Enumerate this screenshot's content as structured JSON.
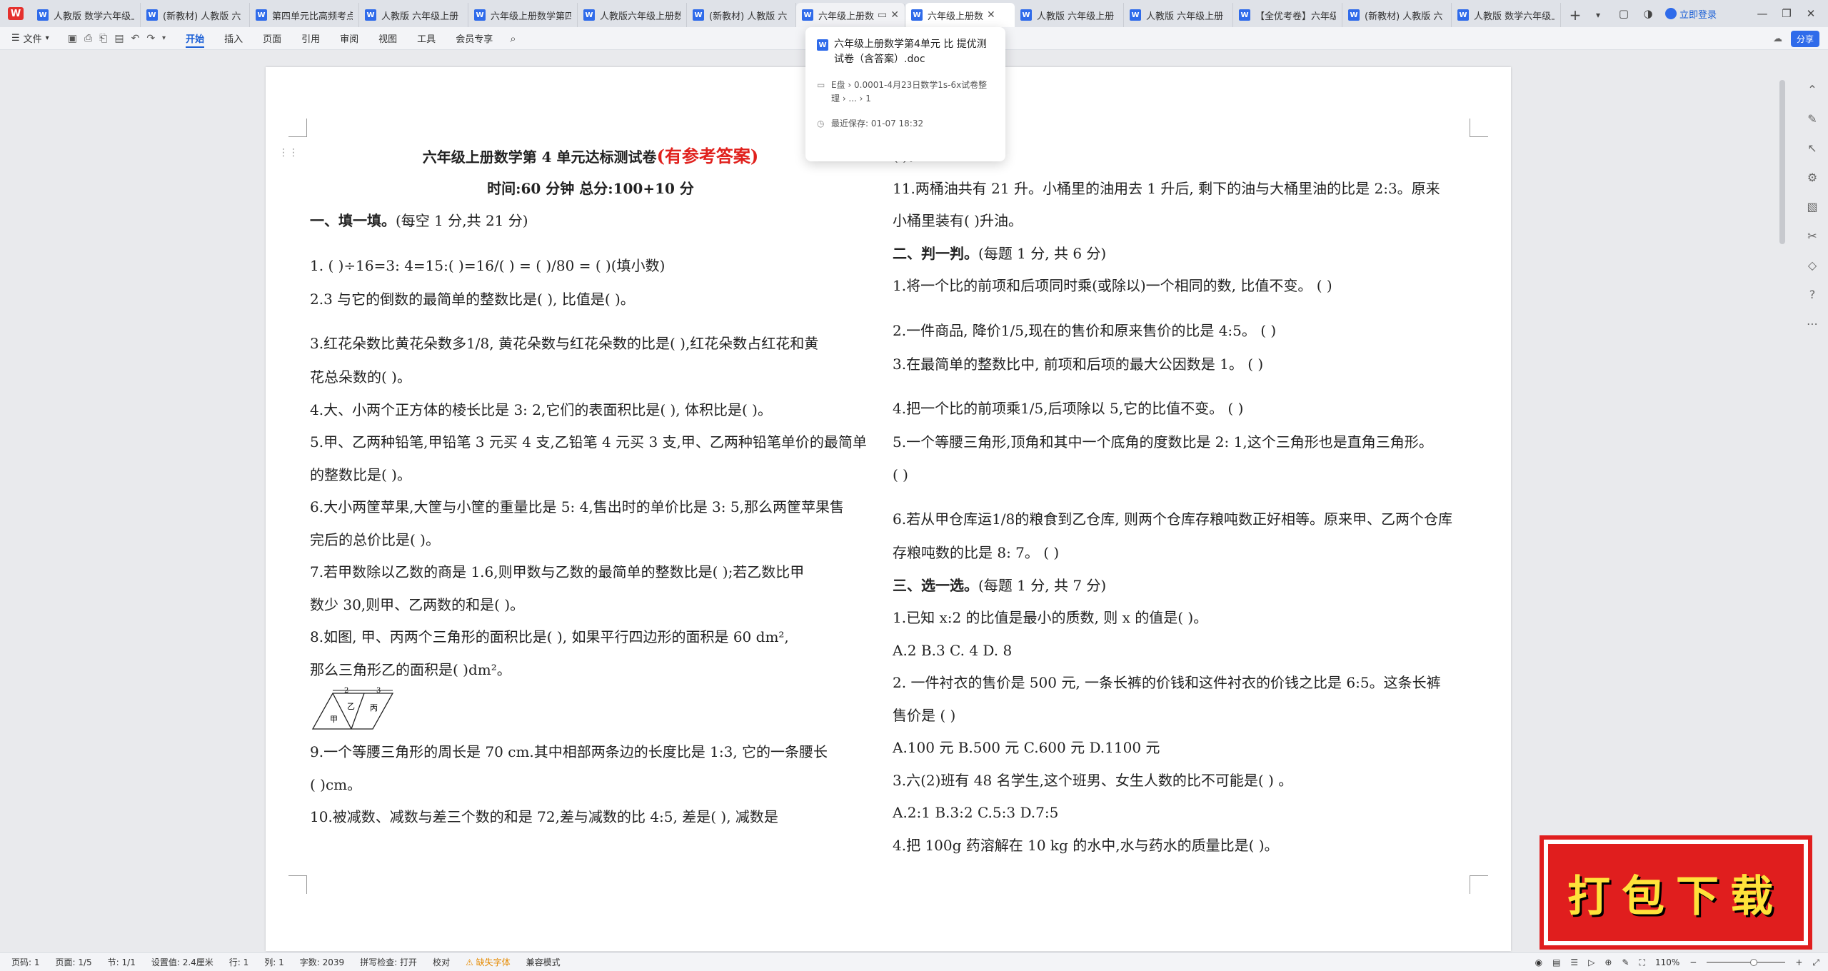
{
  "tabs": [
    {
      "label": "人教版 数学六年级上",
      "state": "normal"
    },
    {
      "label": "(新教材) 人教版 六",
      "state": "normal"
    },
    {
      "label": "第四单元比高频考点",
      "state": "normal"
    },
    {
      "label": "人教版 六年级上册",
      "state": "normal"
    },
    {
      "label": "六年级上册数学第四",
      "state": "normal"
    },
    {
      "label": "人教版六年级上册数",
      "state": "normal"
    },
    {
      "label": "(新教材) 人教版 六",
      "state": "normal"
    },
    {
      "label": "六年级上册数学第",
      "state": "hovered"
    },
    {
      "label": "六年级上册数",
      "state": "active"
    },
    {
      "label": "人教版 六年级上册",
      "state": "normal"
    },
    {
      "label": "人教版 六年级上册",
      "state": "normal"
    },
    {
      "label": "【全优考卷】六年级",
      "state": "normal"
    },
    {
      "label": "(新教材) 人教版 六",
      "state": "normal"
    },
    {
      "label": "人教版 数学六年级上",
      "state": "normal"
    }
  ],
  "titlebar": {
    "login_label": "立即登录"
  },
  "ribbon": {
    "file_label": "文件",
    "menu": [
      "开始",
      "插入",
      "页面",
      "引用",
      "审阅",
      "视图",
      "工具",
      "会员专享"
    ],
    "active_menu": "开始",
    "share_label": "分享"
  },
  "popup": {
    "title": "六年级上册数学第4单元 比 提优测试卷（含答案）.doc",
    "path": "E盘 › 0.0001-4月23日数学1s-6x试卷整理 › ... › 1",
    "saved": "最近保存: 01-07 18:32"
  },
  "document": {
    "left": [
      {
        "type": "title",
        "text": "六年级上册数学第 4 单元达标测试卷",
        "highlight": "(有参考答案)"
      },
      {
        "type": "center",
        "text": "时间:60 分钟    总分:100+10 分"
      },
      {
        "type": "section",
        "head": "一、填一填。",
        "text": "(每空 1 分,共 21 分)"
      },
      {
        "type": "tall",
        "text": "1. (      )÷16=3: 4=15:(      )=16/(   ) = (   )/80 = (      )(填小数)"
      },
      {
        "type": "line",
        "text": "2.3 与它的倒数的最简单的整数比是(         ), 比值是(          )。"
      },
      {
        "type": "tall",
        "text": "3.红花朵数比黄花朵数多1/8, 黄花朵数与红花朵数的比是(         ),红花朵数占红花和黄"
      },
      {
        "type": "line",
        "text": "花总朵数的(         )。"
      },
      {
        "type": "line",
        "text": "4.大、小两个正方体的棱长比是 3: 2,它们的表面积比是(         ), 体积比是(         )。"
      },
      {
        "type": "line",
        "text": "5.甲、乙两种铅笔,甲铅笔 3 元买 4 支,乙铅笔 4 元买 3 支,甲、乙两种铅笔单价的最简单"
      },
      {
        "type": "line",
        "text": "的整数比是(            )。"
      },
      {
        "type": "line",
        "text": "6.大小两筐苹果,大筐与小筐的重量比是 5: 4,售出时的单价比是 3: 5,那么两筐苹果售"
      },
      {
        "type": "line",
        "text": "完后的总价比是(            )。"
      },
      {
        "type": "line",
        "text": "7.若甲数除以乙数的商是 1.6,则甲数与乙数的最简单的整数比是(         );若乙数比甲"
      },
      {
        "type": "line",
        "text": "数少 30,则甲、乙两数的和是(            )。"
      },
      {
        "type": "line",
        "text": "8.如图, 甲、丙两个三角形的面积比是(         ), 如果平行四边形的面积是 60 dm², "
      },
      {
        "type": "line",
        "text": "那么三角形乙的面积是(          )dm²。"
      },
      {
        "type": "figure",
        "labels": [
          "2",
          "3",
          "甲",
          "乙",
          "丙"
        ]
      },
      {
        "type": "line",
        "text": "9.一个等腰三角形的周长是 70 cm.其中相部两条边的长度比是 1:3, 它的一条腰长"
      },
      {
        "type": "line",
        "text": "(           )cm。"
      },
      {
        "type": "line",
        "text": "10.被减数、减数与差三个数的和是 72,差与减数的比 4:5, 差是(          ), 减数是"
      }
    ],
    "right": [
      {
        "type": "line",
        "text": "(             )。"
      },
      {
        "type": "line",
        "text": "11.两桶油共有 21 升。小桶里的油用去 1 升后, 剩下的油与大桶里油的比是 2:3。原来"
      },
      {
        "type": "line",
        "text": "小桶里装有(          )升油。"
      },
      {
        "type": "section",
        "head": "二、判一判。",
        "text": "(每题 1 分, 共 6 分)"
      },
      {
        "type": "line",
        "text": "1.将一个比的前项和后项同时乘(或除以)一个相同的数, 比值不变。    (          )"
      },
      {
        "type": "tall",
        "text": "2.一件商品, 降价1/5,现在的售价和原来售价的比是 4:5。       (        )"
      },
      {
        "type": "line",
        "text": "3.在最简单的整数比中, 前项和后项的最大公因数是 1。       (        )"
      },
      {
        "type": "tall",
        "text": "4.把一个比的前项乘1/5,后项除以 5,它的比值不变。          (        )"
      },
      {
        "type": "line",
        "text": "5.一个等腰三角形,顶角和其中一个底角的度数比是 2: 1,这个三角形也是直角三角形。"
      },
      {
        "type": "line",
        "text": "(        )"
      },
      {
        "type": "tall",
        "text": "6.若从甲仓库运1/8的粮食到乙仓库, 则两个仓库存粮吨数正好相等。原来甲、乙两个仓库"
      },
      {
        "type": "line",
        "text": "存粮吨数的比是 8: 7。       (        )"
      },
      {
        "type": "section",
        "head": "三、选一选。",
        "text": "(每题 1 分, 共 7 分)"
      },
      {
        "type": "line",
        "text": "1.已知 x:2 的比值是最小的质数, 则 x 的值是(        )。"
      },
      {
        "type": "line",
        "text": "A.2              B.3              C. 4              D. 8"
      },
      {
        "type": "line",
        "text": "2.  一件衬衣的售价是 500 元, 一条长裤的价钱和这件衬衣的价钱之比是 6:5。这条长裤"
      },
      {
        "type": "line",
        "text": "售价是 (       )"
      },
      {
        "type": "line",
        "text": "A.100 元           B.500 元           C.600 元           D.1100 元"
      },
      {
        "type": "line",
        "text": "3.六(2)班有 48 名学生,这个班男、女生人数的比不可能是(        ) 。"
      },
      {
        "type": "line",
        "text": "A.2:1              B.3:2              C.5:3              D.7:5"
      },
      {
        "type": "line",
        "text": "4.把 100g 药溶解在 10 kg 的水中,水与药水的质量比是(        )。"
      }
    ]
  },
  "download_banner": "打包下载",
  "statusbar": {
    "page_code": "页码: 1",
    "page_count": "页面: 1/5",
    "section": "节: 1/1",
    "setting": "设置值: 2.4厘米",
    "row": "行: 1",
    "col": "列: 1",
    "word_count": "字数: 2039",
    "spellcheck": "拼写检查: 打开",
    "proof": "校对",
    "missing_font": "缺失字体",
    "compat": "兼容模式",
    "zoom": "110%",
    "zoom_fraction": 0.55
  }
}
